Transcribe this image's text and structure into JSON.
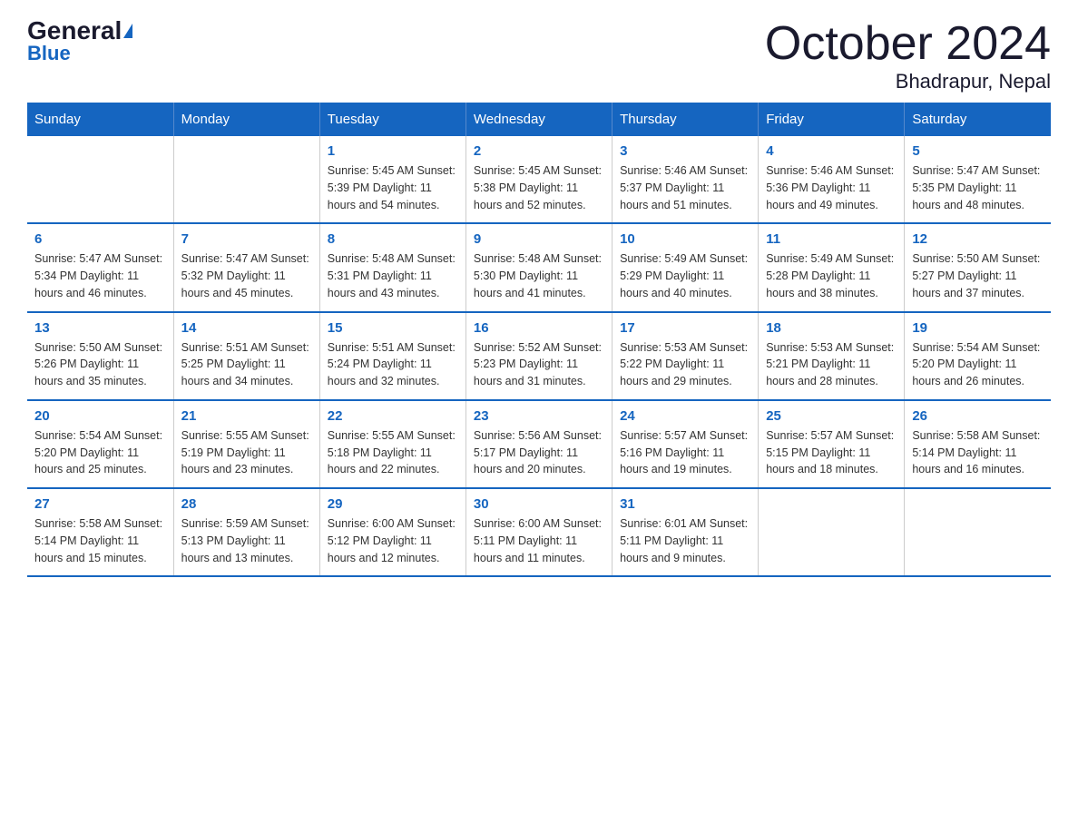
{
  "header": {
    "logo_general": "General",
    "logo_blue": "Blue",
    "title": "October 2024",
    "subtitle": "Bhadrapur, Nepal"
  },
  "days_of_week": [
    "Sunday",
    "Monday",
    "Tuesday",
    "Wednesday",
    "Thursday",
    "Friday",
    "Saturday"
  ],
  "weeks": [
    {
      "days": [
        {
          "num": "",
          "info": ""
        },
        {
          "num": "",
          "info": ""
        },
        {
          "num": "1",
          "info": "Sunrise: 5:45 AM\nSunset: 5:39 PM\nDaylight: 11 hours\nand 54 minutes."
        },
        {
          "num": "2",
          "info": "Sunrise: 5:45 AM\nSunset: 5:38 PM\nDaylight: 11 hours\nand 52 minutes."
        },
        {
          "num": "3",
          "info": "Sunrise: 5:46 AM\nSunset: 5:37 PM\nDaylight: 11 hours\nand 51 minutes."
        },
        {
          "num": "4",
          "info": "Sunrise: 5:46 AM\nSunset: 5:36 PM\nDaylight: 11 hours\nand 49 minutes."
        },
        {
          "num": "5",
          "info": "Sunrise: 5:47 AM\nSunset: 5:35 PM\nDaylight: 11 hours\nand 48 minutes."
        }
      ]
    },
    {
      "days": [
        {
          "num": "6",
          "info": "Sunrise: 5:47 AM\nSunset: 5:34 PM\nDaylight: 11 hours\nand 46 minutes."
        },
        {
          "num": "7",
          "info": "Sunrise: 5:47 AM\nSunset: 5:32 PM\nDaylight: 11 hours\nand 45 minutes."
        },
        {
          "num": "8",
          "info": "Sunrise: 5:48 AM\nSunset: 5:31 PM\nDaylight: 11 hours\nand 43 minutes."
        },
        {
          "num": "9",
          "info": "Sunrise: 5:48 AM\nSunset: 5:30 PM\nDaylight: 11 hours\nand 41 minutes."
        },
        {
          "num": "10",
          "info": "Sunrise: 5:49 AM\nSunset: 5:29 PM\nDaylight: 11 hours\nand 40 minutes."
        },
        {
          "num": "11",
          "info": "Sunrise: 5:49 AM\nSunset: 5:28 PM\nDaylight: 11 hours\nand 38 minutes."
        },
        {
          "num": "12",
          "info": "Sunrise: 5:50 AM\nSunset: 5:27 PM\nDaylight: 11 hours\nand 37 minutes."
        }
      ]
    },
    {
      "days": [
        {
          "num": "13",
          "info": "Sunrise: 5:50 AM\nSunset: 5:26 PM\nDaylight: 11 hours\nand 35 minutes."
        },
        {
          "num": "14",
          "info": "Sunrise: 5:51 AM\nSunset: 5:25 PM\nDaylight: 11 hours\nand 34 minutes."
        },
        {
          "num": "15",
          "info": "Sunrise: 5:51 AM\nSunset: 5:24 PM\nDaylight: 11 hours\nand 32 minutes."
        },
        {
          "num": "16",
          "info": "Sunrise: 5:52 AM\nSunset: 5:23 PM\nDaylight: 11 hours\nand 31 minutes."
        },
        {
          "num": "17",
          "info": "Sunrise: 5:53 AM\nSunset: 5:22 PM\nDaylight: 11 hours\nand 29 minutes."
        },
        {
          "num": "18",
          "info": "Sunrise: 5:53 AM\nSunset: 5:21 PM\nDaylight: 11 hours\nand 28 minutes."
        },
        {
          "num": "19",
          "info": "Sunrise: 5:54 AM\nSunset: 5:20 PM\nDaylight: 11 hours\nand 26 minutes."
        }
      ]
    },
    {
      "days": [
        {
          "num": "20",
          "info": "Sunrise: 5:54 AM\nSunset: 5:20 PM\nDaylight: 11 hours\nand 25 minutes."
        },
        {
          "num": "21",
          "info": "Sunrise: 5:55 AM\nSunset: 5:19 PM\nDaylight: 11 hours\nand 23 minutes."
        },
        {
          "num": "22",
          "info": "Sunrise: 5:55 AM\nSunset: 5:18 PM\nDaylight: 11 hours\nand 22 minutes."
        },
        {
          "num": "23",
          "info": "Sunrise: 5:56 AM\nSunset: 5:17 PM\nDaylight: 11 hours\nand 20 minutes."
        },
        {
          "num": "24",
          "info": "Sunrise: 5:57 AM\nSunset: 5:16 PM\nDaylight: 11 hours\nand 19 minutes."
        },
        {
          "num": "25",
          "info": "Sunrise: 5:57 AM\nSunset: 5:15 PM\nDaylight: 11 hours\nand 18 minutes."
        },
        {
          "num": "26",
          "info": "Sunrise: 5:58 AM\nSunset: 5:14 PM\nDaylight: 11 hours\nand 16 minutes."
        }
      ]
    },
    {
      "days": [
        {
          "num": "27",
          "info": "Sunrise: 5:58 AM\nSunset: 5:14 PM\nDaylight: 11 hours\nand 15 minutes."
        },
        {
          "num": "28",
          "info": "Sunrise: 5:59 AM\nSunset: 5:13 PM\nDaylight: 11 hours\nand 13 minutes."
        },
        {
          "num": "29",
          "info": "Sunrise: 6:00 AM\nSunset: 5:12 PM\nDaylight: 11 hours\nand 12 minutes."
        },
        {
          "num": "30",
          "info": "Sunrise: 6:00 AM\nSunset: 5:11 PM\nDaylight: 11 hours\nand 11 minutes."
        },
        {
          "num": "31",
          "info": "Sunrise: 6:01 AM\nSunset: 5:11 PM\nDaylight: 11 hours\nand 9 minutes."
        },
        {
          "num": "",
          "info": ""
        },
        {
          "num": "",
          "info": ""
        }
      ]
    }
  ]
}
